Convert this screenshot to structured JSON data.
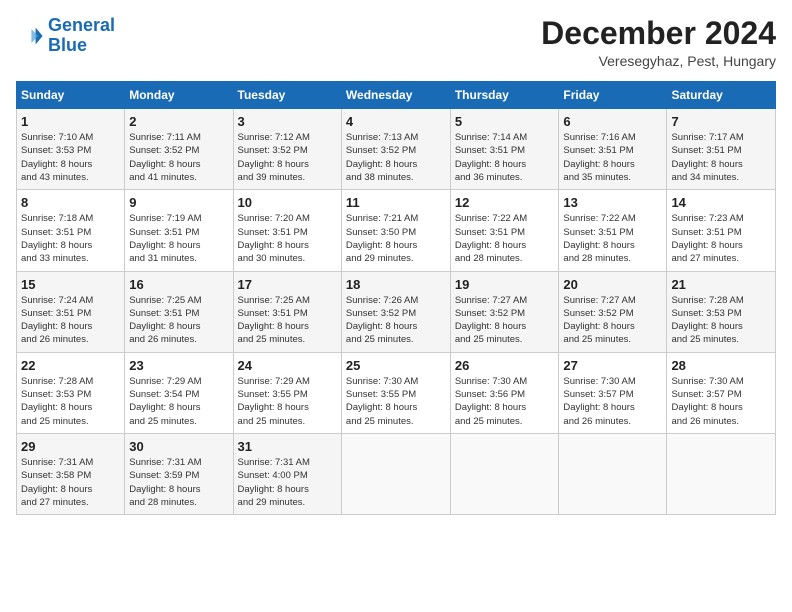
{
  "header": {
    "logo_line1": "General",
    "logo_line2": "Blue",
    "month": "December 2024",
    "location": "Veresegyhaz, Pest, Hungary"
  },
  "weekdays": [
    "Sunday",
    "Monday",
    "Tuesday",
    "Wednesday",
    "Thursday",
    "Friday",
    "Saturday"
  ],
  "weeks": [
    [
      {
        "day": "1",
        "info": "Sunrise: 7:10 AM\nSunset: 3:53 PM\nDaylight: 8 hours\nand 43 minutes."
      },
      {
        "day": "2",
        "info": "Sunrise: 7:11 AM\nSunset: 3:52 PM\nDaylight: 8 hours\nand 41 minutes."
      },
      {
        "day": "3",
        "info": "Sunrise: 7:12 AM\nSunset: 3:52 PM\nDaylight: 8 hours\nand 39 minutes."
      },
      {
        "day": "4",
        "info": "Sunrise: 7:13 AM\nSunset: 3:52 PM\nDaylight: 8 hours\nand 38 minutes."
      },
      {
        "day": "5",
        "info": "Sunrise: 7:14 AM\nSunset: 3:51 PM\nDaylight: 8 hours\nand 36 minutes."
      },
      {
        "day": "6",
        "info": "Sunrise: 7:16 AM\nSunset: 3:51 PM\nDaylight: 8 hours\nand 35 minutes."
      },
      {
        "day": "7",
        "info": "Sunrise: 7:17 AM\nSunset: 3:51 PM\nDaylight: 8 hours\nand 34 minutes."
      }
    ],
    [
      {
        "day": "8",
        "info": "Sunrise: 7:18 AM\nSunset: 3:51 PM\nDaylight: 8 hours\nand 33 minutes."
      },
      {
        "day": "9",
        "info": "Sunrise: 7:19 AM\nSunset: 3:51 PM\nDaylight: 8 hours\nand 31 minutes."
      },
      {
        "day": "10",
        "info": "Sunrise: 7:20 AM\nSunset: 3:51 PM\nDaylight: 8 hours\nand 30 minutes."
      },
      {
        "day": "11",
        "info": "Sunrise: 7:21 AM\nSunset: 3:50 PM\nDaylight: 8 hours\nand 29 minutes."
      },
      {
        "day": "12",
        "info": "Sunrise: 7:22 AM\nSunset: 3:51 PM\nDaylight: 8 hours\nand 28 minutes."
      },
      {
        "day": "13",
        "info": "Sunrise: 7:22 AM\nSunset: 3:51 PM\nDaylight: 8 hours\nand 28 minutes."
      },
      {
        "day": "14",
        "info": "Sunrise: 7:23 AM\nSunset: 3:51 PM\nDaylight: 8 hours\nand 27 minutes."
      }
    ],
    [
      {
        "day": "15",
        "info": "Sunrise: 7:24 AM\nSunset: 3:51 PM\nDaylight: 8 hours\nand 26 minutes."
      },
      {
        "day": "16",
        "info": "Sunrise: 7:25 AM\nSunset: 3:51 PM\nDaylight: 8 hours\nand 26 minutes."
      },
      {
        "day": "17",
        "info": "Sunrise: 7:25 AM\nSunset: 3:51 PM\nDaylight: 8 hours\nand 25 minutes."
      },
      {
        "day": "18",
        "info": "Sunrise: 7:26 AM\nSunset: 3:52 PM\nDaylight: 8 hours\nand 25 minutes."
      },
      {
        "day": "19",
        "info": "Sunrise: 7:27 AM\nSunset: 3:52 PM\nDaylight: 8 hours\nand 25 minutes."
      },
      {
        "day": "20",
        "info": "Sunrise: 7:27 AM\nSunset: 3:52 PM\nDaylight: 8 hours\nand 25 minutes."
      },
      {
        "day": "21",
        "info": "Sunrise: 7:28 AM\nSunset: 3:53 PM\nDaylight: 8 hours\nand 25 minutes."
      }
    ],
    [
      {
        "day": "22",
        "info": "Sunrise: 7:28 AM\nSunset: 3:53 PM\nDaylight: 8 hours\nand 25 minutes."
      },
      {
        "day": "23",
        "info": "Sunrise: 7:29 AM\nSunset: 3:54 PM\nDaylight: 8 hours\nand 25 minutes."
      },
      {
        "day": "24",
        "info": "Sunrise: 7:29 AM\nSunset: 3:55 PM\nDaylight: 8 hours\nand 25 minutes."
      },
      {
        "day": "25",
        "info": "Sunrise: 7:30 AM\nSunset: 3:55 PM\nDaylight: 8 hours\nand 25 minutes."
      },
      {
        "day": "26",
        "info": "Sunrise: 7:30 AM\nSunset: 3:56 PM\nDaylight: 8 hours\nand 25 minutes."
      },
      {
        "day": "27",
        "info": "Sunrise: 7:30 AM\nSunset: 3:57 PM\nDaylight: 8 hours\nand 26 minutes."
      },
      {
        "day": "28",
        "info": "Sunrise: 7:30 AM\nSunset: 3:57 PM\nDaylight: 8 hours\nand 26 minutes."
      }
    ],
    [
      {
        "day": "29",
        "info": "Sunrise: 7:31 AM\nSunset: 3:58 PM\nDaylight: 8 hours\nand 27 minutes."
      },
      {
        "day": "30",
        "info": "Sunrise: 7:31 AM\nSunset: 3:59 PM\nDaylight: 8 hours\nand 28 minutes."
      },
      {
        "day": "31",
        "info": "Sunrise: 7:31 AM\nSunset: 4:00 PM\nDaylight: 8 hours\nand 29 minutes."
      },
      {
        "day": "",
        "info": ""
      },
      {
        "day": "",
        "info": ""
      },
      {
        "day": "",
        "info": ""
      },
      {
        "day": "",
        "info": ""
      }
    ]
  ]
}
